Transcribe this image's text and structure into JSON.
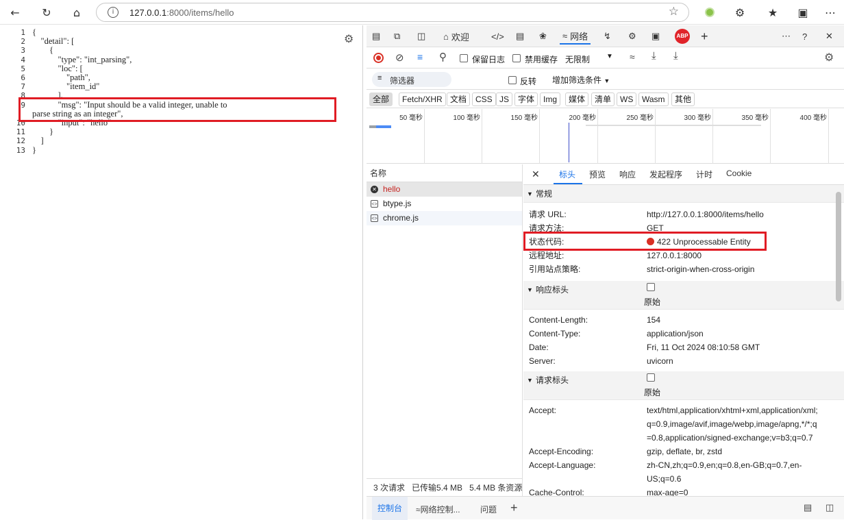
{
  "browser": {
    "url_host": "127.0.0.1",
    "url_rest": ":8000/items/hello",
    "icons": [
      "back-icon",
      "refresh-icon",
      "home-icon",
      "info-icon",
      "star-icon",
      "extension-icon",
      "favorites-icon",
      "profile-icon"
    ]
  },
  "json_view": {
    "lines": [
      {
        "n": "1",
        "t": "{"
      },
      {
        "n": "2",
        "t": "    \"detail\": ["
      },
      {
        "n": "3",
        "t": "        {"
      },
      {
        "n": "4",
        "t": "            \"type\": \"int_parsing\","
      },
      {
        "n": "5",
        "t": "            \"loc\": ["
      },
      {
        "n": "6",
        "t": "                \"path\","
      },
      {
        "n": "7",
        "t": "                \"item_id\""
      },
      {
        "n": "8",
        "t": "            ],"
      },
      {
        "n": "9",
        "t": "            \"msg\": \"Input should be a valid integer, unable to"
      },
      {
        "n": "",
        "t": "parse string as an integer\","
      },
      {
        "n": "10",
        "t": "            \"input\": \"hello\""
      },
      {
        "n": "11",
        "t": "        }"
      },
      {
        "n": "12",
        "t": "    ]"
      },
      {
        "n": "13",
        "t": "}"
      }
    ]
  },
  "devtools": {
    "tabs": [
      "欢迎",
      "网络"
    ],
    "toolbar": {
      "preserve_log": "保留日志",
      "disable_cache": "禁用缓存",
      "throttle": "无限制"
    },
    "filter": {
      "placeholder": "筛选器",
      "invert": "反转",
      "more": "增加筛选条件"
    },
    "types": [
      "全部",
      "Fetch/XHR",
      "文档",
      "CSS",
      "JS",
      "字体",
      "Img",
      "媒体",
      "清单",
      "WS",
      "Wasm",
      "其他"
    ],
    "timeline_ticks": [
      "50 毫秒",
      "100 毫秒",
      "150 毫秒",
      "200 毫秒",
      "250 毫秒",
      "300 毫秒",
      "350 毫秒",
      "400 毫秒"
    ],
    "names_header": "名称",
    "requests": [
      {
        "name": "hello",
        "status": "error"
      },
      {
        "name": "btype.js",
        "status": "ok"
      },
      {
        "name": "chrome.js",
        "status": "ok"
      }
    ],
    "summary": {
      "requests": "3 次请求",
      "transferred": "已传输5.4 MB",
      "resources": "5.4 MB 条资源"
    },
    "detail_tabs": [
      "标头",
      "预览",
      "响应",
      "发起程序",
      "计时",
      "Cookie"
    ],
    "general": {
      "title": "常规",
      "rows": [
        {
          "k": "请求 URL:",
          "v": "http://127.0.0.1:8000/items/hello"
        },
        {
          "k": "请求方法:",
          "v": "GET"
        },
        {
          "k": "状态代码:",
          "v": "422 Unprocessable Entity"
        },
        {
          "k": "远程地址:",
          "v": "127.0.0.1:8000"
        },
        {
          "k": "引用站点策略:",
          "v": "strict-origin-when-cross-origin"
        }
      ]
    },
    "response_headers": {
      "title": "响应标头",
      "raw": "原始",
      "rows": [
        {
          "k": "Content-Length:",
          "v": "154"
        },
        {
          "k": "Content-Type:",
          "v": "application/json"
        },
        {
          "k": "Date:",
          "v": "Fri, 11 Oct 2024 08:10:58 GMT"
        },
        {
          "k": "Server:",
          "v": "uvicorn"
        }
      ]
    },
    "request_headers": {
      "title": "请求标头",
      "raw": "原始",
      "rows": [
        {
          "k": "Accept:",
          "v1": "text/html,application/xhtml+xml,application/xml;",
          "v2": "q=0.9,image/avif,image/webp,image/apng,*/*;q",
          "v3": "=0.8,application/signed-exchange;v=b3;q=0.7"
        },
        {
          "k": "Accept-Encoding:",
          "v": "gzip, deflate, br, zstd"
        },
        {
          "k": "Accept-Language:",
          "v1": "zh-CN,zh;q=0.9,en;q=0.8,en-GB;q=0.7,en-",
          "v2": "US;q=0.6"
        },
        {
          "k": "Cache-Control:",
          "v": "max-age=0"
        }
      ]
    },
    "bottom_tabs": [
      "控制台",
      "网络控制...",
      "问题"
    ]
  }
}
